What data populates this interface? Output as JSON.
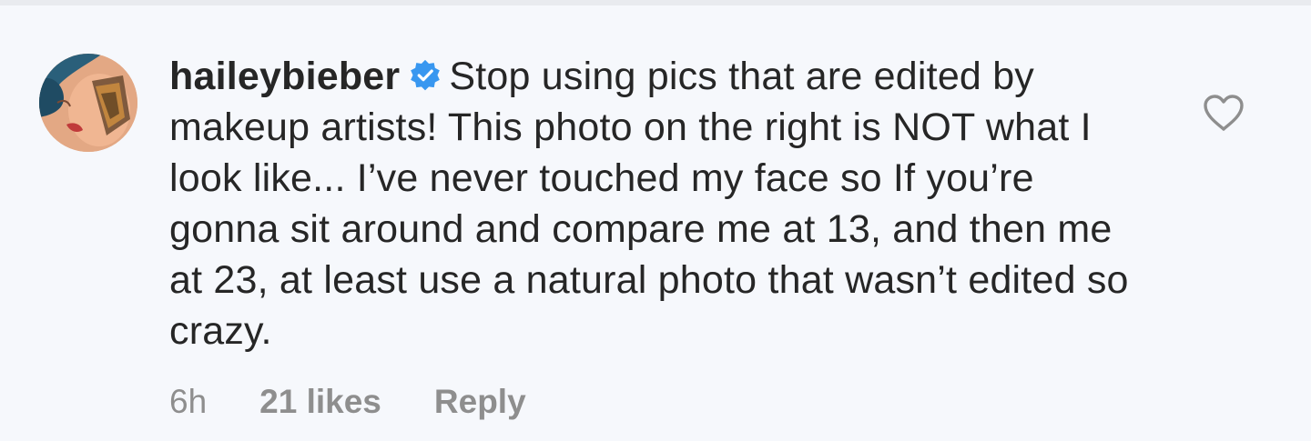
{
  "comment": {
    "avatar_icon": "user-avatar",
    "username": "haileybieber",
    "verified_icon": "verified-badge-icon",
    "verified_color": "#3897f0",
    "text": "Stop using pics that are edited by makeup artists! This photo on the right is NOT what I look like... I’ve never touched my face so If you’re gonna sit around and compare me at 13, and then me at 23, at least use a natural photo that wasn’t edited so crazy.",
    "like_icon": "heart-outline-icon",
    "timestamp": "6h",
    "likes": "21 likes",
    "reply_label": "Reply"
  },
  "colors": {
    "background": "#f6f8fc",
    "text": "#262626",
    "meta": "#8e8e8e"
  }
}
